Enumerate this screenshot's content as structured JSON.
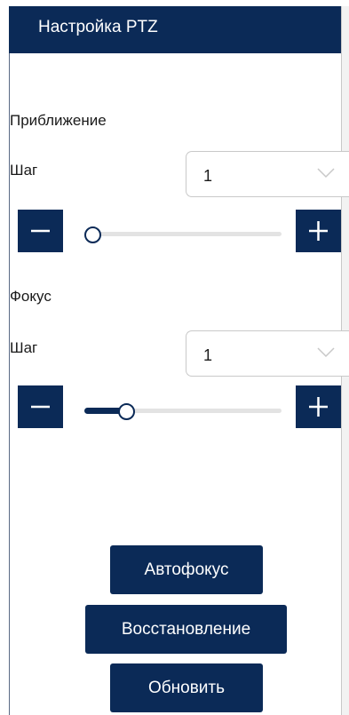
{
  "header": {
    "title": "Настройка PTZ"
  },
  "zoom": {
    "section_label": "Приближение",
    "step_label": "Шаг",
    "step_value": "1",
    "slider_level": 0.0
  },
  "focus": {
    "section_label": "Фокус",
    "step_label": "Шаг",
    "step_value": "1",
    "slider_level": 0.17
  },
  "buttons": {
    "autofocus": "Автофокус",
    "restore": "Восстановление",
    "refresh": "Обновить"
  },
  "icons": {
    "minus": "minus-icon",
    "plus": "plus-icon",
    "chevron": "chevron-down-icon"
  },
  "colors": {
    "accent": "#0b2a57",
    "background": "#ffffff",
    "track": "#e3e3e3"
  }
}
